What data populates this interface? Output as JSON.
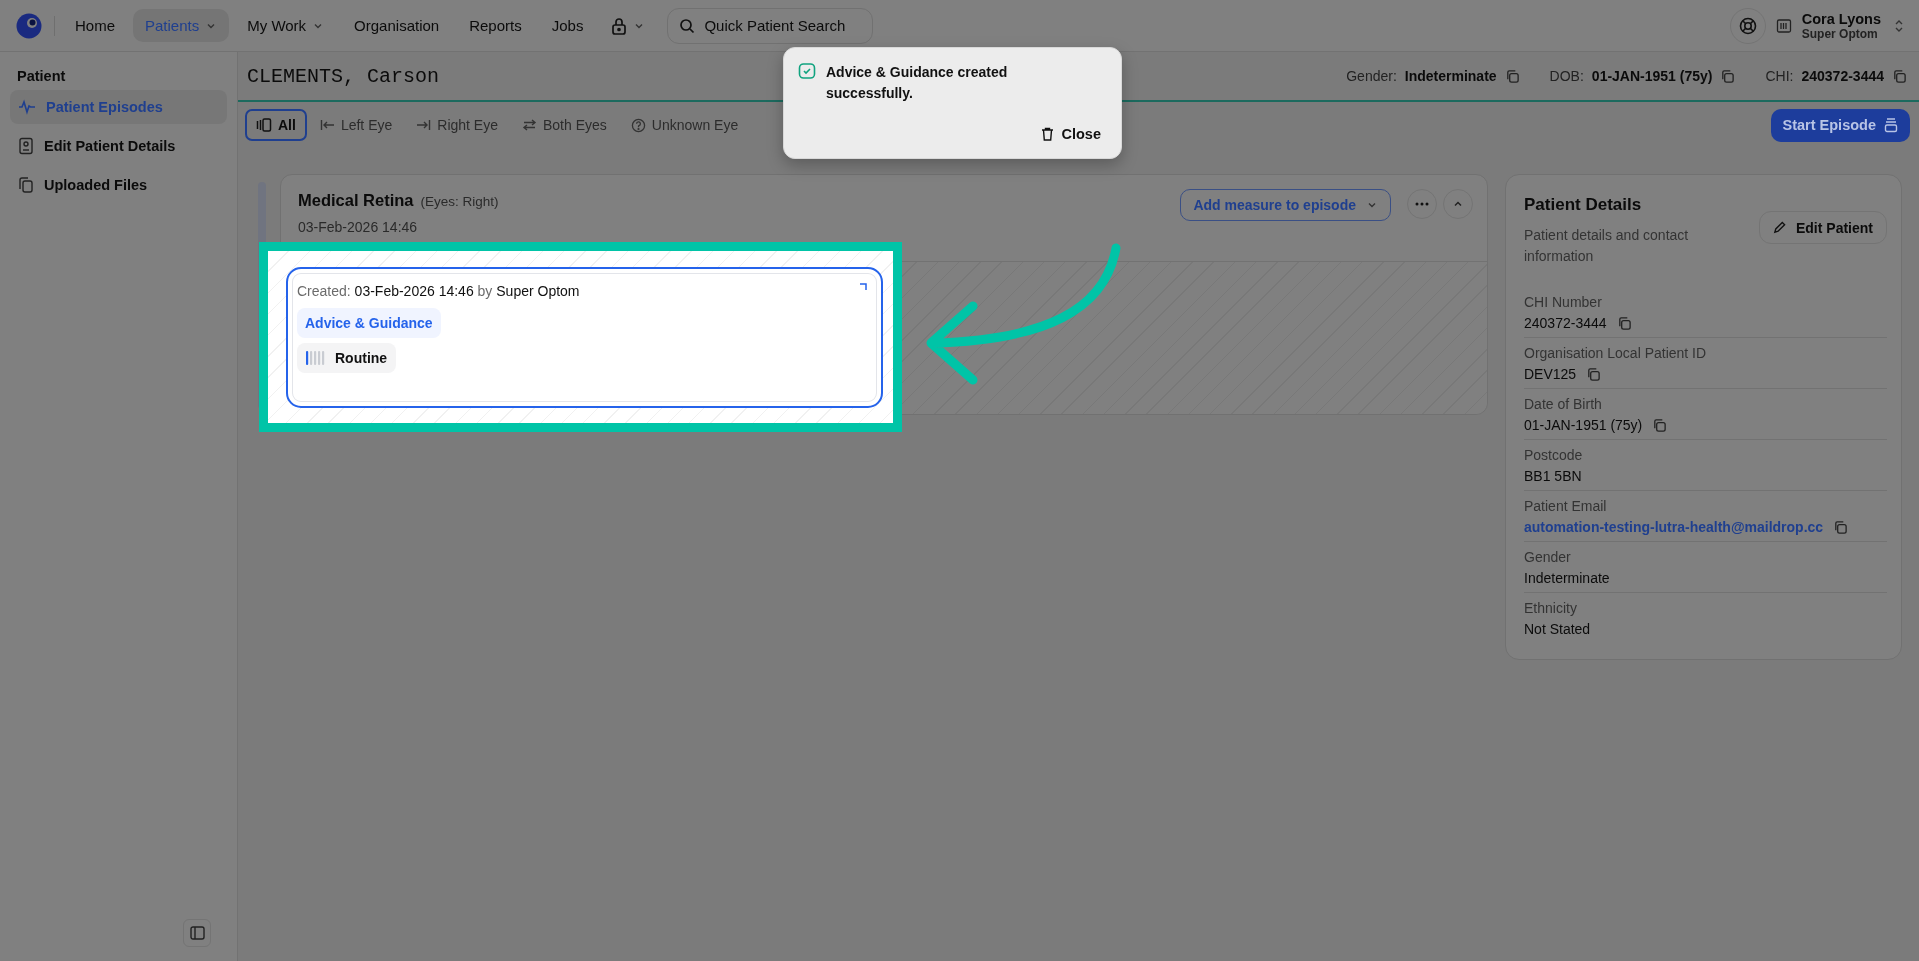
{
  "nav": {
    "items": [
      {
        "label": "Home",
        "selected": false,
        "kind": "link"
      },
      {
        "label": "Patients",
        "selected": true,
        "kind": "dropdown"
      },
      {
        "label": "My Work",
        "selected": false,
        "kind": "dropdown"
      },
      {
        "label": "Organisation",
        "selected": false,
        "kind": "link"
      },
      {
        "label": "Reports",
        "selected": false,
        "kind": "link"
      },
      {
        "label": "Jobs",
        "selected": false,
        "kind": "link"
      }
    ],
    "search": {
      "placeholder": "Quick Patient Search"
    },
    "user": {
      "name": "Cora Lyons",
      "role": "Super Optom"
    }
  },
  "sidebar": {
    "heading": "Patient",
    "items": [
      {
        "label": "Patient Episodes",
        "selected": true,
        "kind": "pulse"
      },
      {
        "label": "Edit Patient Details",
        "selected": false,
        "kind": "form"
      },
      {
        "label": "Uploaded Files",
        "selected": false,
        "kind": "files"
      }
    ]
  },
  "patient": {
    "name": "CLEMENTS, Carson",
    "facts": [
      {
        "label": "Gender:",
        "value": "Indeterminate"
      },
      {
        "label": "DOB:",
        "value": "01-JAN-1951 (75y)"
      },
      {
        "label": "CHI:",
        "value": "240372-3444"
      }
    ]
  },
  "eye_filters": [
    {
      "label": "All",
      "selected": true,
      "kind": "all"
    },
    {
      "label": "Left Eye",
      "selected": false,
      "kind": "left"
    },
    {
      "label": "Right Eye",
      "selected": false,
      "kind": "right"
    },
    {
      "label": "Both Eyes",
      "selected": false,
      "kind": "both"
    },
    {
      "label": "Unknown Eye",
      "selected": false,
      "kind": "unknown"
    }
  ],
  "start_button": "Start Episode",
  "episode": {
    "title": "Medical Retina",
    "eyes": "(Eyes: Right)",
    "date": "03-Feb-2026 14:46",
    "add_button": "Add measure to episode",
    "expanded": true,
    "note": {
      "created": "Created: **03-Feb-2026 14:46** by **Super Optom**",
      "tag": "Advice & Guidance",
      "priority": {
        "label": "Routine",
        "level": 0.2
      }
    }
  },
  "details": {
    "title": "Patient Details",
    "subtitle": "Patient details and contact information",
    "edit_button": "Edit Patient",
    "fields": [
      {
        "label": "CHI Number",
        "value": "240372-3444",
        "kind": "text",
        "copy": true
      },
      {
        "label": "Organisation Local Patient ID",
        "value": "DEV125",
        "kind": "text",
        "copy": true
      },
      {
        "label": "Date of Birth",
        "value": "01-JAN-1951 (75y)",
        "kind": "text",
        "copy": true
      },
      {
        "label": "Postcode",
        "value": "BB1 5BN",
        "kind": "text",
        "copy": false
      },
      {
        "label": "Patient Email",
        "value": "automation-testing-lutra-health@maildrop.cc",
        "kind": "link",
        "copy": true
      },
      {
        "label": "Gender",
        "value": "Indeterminate",
        "kind": "text",
        "copy": false
      },
      {
        "label": "Ethnicity",
        "value": "Not Stated",
        "kind": "text",
        "copy": false
      }
    ]
  },
  "toast": {
    "message": "Advice & Guidance created successfully.",
    "close": "Close"
  }
}
